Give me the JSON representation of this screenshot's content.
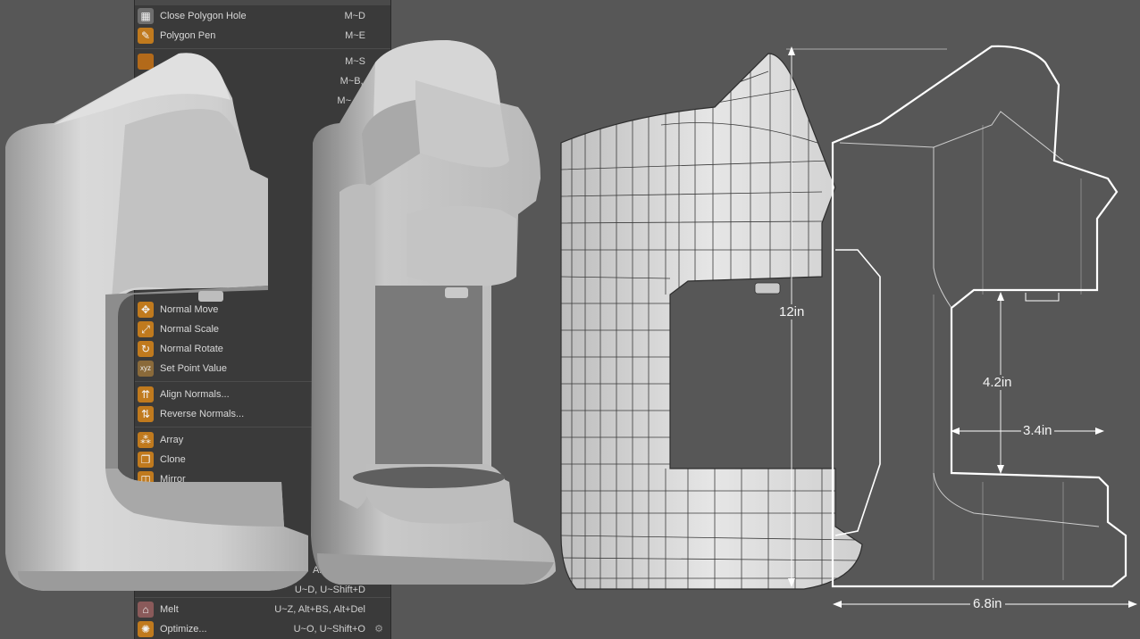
{
  "menu": {
    "items": [
      {
        "label": "Close Polygon Hole",
        "shortcut": "M~D",
        "icon": "close-polygon-hole-icon",
        "color": "#6e6e6e"
      },
      {
        "label": "Polygon Pen",
        "shortcut": "M~E",
        "icon": "polygon-pen-icon",
        "color": "#c07a1e"
      },
      {
        "label": "",
        "shortcut": "M~S",
        "icon": "",
        "color": "#b36a1a"
      },
      {
        "label": "",
        "shortcut": "M~B, B",
        "icon": "",
        "color": ""
      },
      {
        "label": "",
        "shortcut": "M~",
        "icon": "",
        "color": ""
      },
      {
        "label": "Normal Move",
        "shortcut": "",
        "icon": "normal-move-icon",
        "color": "#c07a1e"
      },
      {
        "label": "Normal Scale",
        "shortcut": "",
        "icon": "normal-scale-icon",
        "color": "#c07a1e"
      },
      {
        "label": "Normal Rotate",
        "shortcut": "",
        "icon": "normal-rotate-icon",
        "color": "#c07a1e"
      },
      {
        "label": "Set Point Value",
        "shortcut": "",
        "icon": "set-point-value-icon",
        "color": "#8a6a3a",
        "glyph": "xyz"
      },
      {
        "label": "Align Normals...",
        "shortcut": "",
        "icon": "align-normals-icon",
        "color": "#c07a1e"
      },
      {
        "label": "Reverse Normals...",
        "shortcut": "",
        "icon": "reverse-normals-icon",
        "color": "#c07a1e"
      },
      {
        "label": "Array",
        "shortcut": "",
        "icon": "array-icon",
        "color": "#c07a1e"
      },
      {
        "label": "Clone",
        "shortcut": "",
        "icon": "clone-icon",
        "color": "#c07a1e"
      },
      {
        "label": "Mirror",
        "shortcut": "",
        "icon": "mirror-icon",
        "color": "#c07a1e"
      },
      {
        "label": "",
        "shortcut": "Alt+BS,",
        "icon": "",
        "color": ""
      },
      {
        "label": "",
        "shortcut": "U~D, U~Shift+D",
        "icon": "",
        "color": ""
      },
      {
        "label": "Melt",
        "shortcut": "U~Z, Alt+BS, Alt+Del",
        "icon": "melt-icon",
        "color": "#8a5a5a"
      },
      {
        "label": "Optimize...",
        "shortcut": "U~O, U~Shift+O",
        "icon": "optimize-icon",
        "color": "#c07a1e"
      }
    ]
  },
  "drawing": {
    "height_label": "12in",
    "depth_label": "4.2in",
    "opening_label": "3.4in",
    "width_label": "6.8in"
  },
  "colors": {
    "background": "#575757",
    "menu_bg": "#3a3a3a",
    "menu_text": "#d8d8d8",
    "icon_orange": "#c07a1e",
    "model_light": "#d2d2d2",
    "model_shadow": "#6d6d6d",
    "line_white": "#ffffff"
  }
}
